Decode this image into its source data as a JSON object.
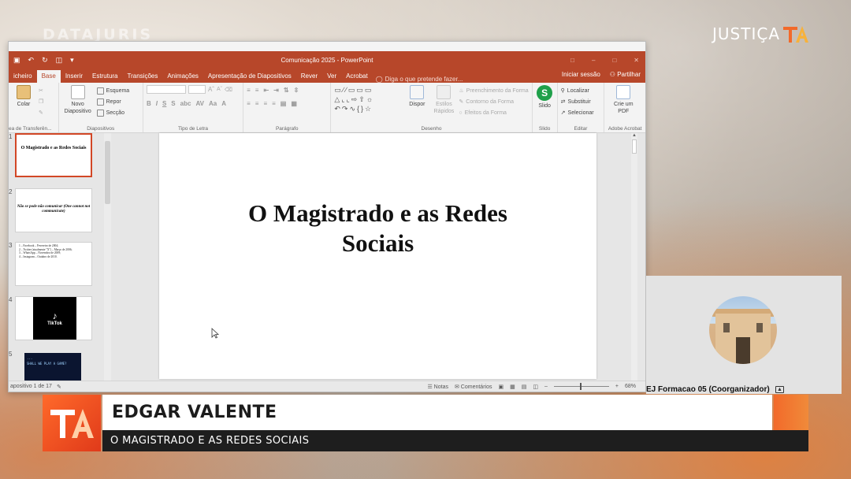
{
  "broadcast": {
    "left_watermark": "DATAJURIS",
    "brand_text": "JUSTIÇA",
    "brand_colors": {
      "accent": "#f26a2a",
      "lower_bar_dark": "#1e1e1e"
    }
  },
  "powerpoint": {
    "title": "Comunicação 2025 - PowerPoint",
    "tabs": [
      {
        "label": "icheiro"
      },
      {
        "label": "Base",
        "active": true
      },
      {
        "label": "Inserir"
      },
      {
        "label": "Estrutura"
      },
      {
        "label": "Transições"
      },
      {
        "label": "Animações"
      },
      {
        "label": "Apresentação de Diapositivos"
      },
      {
        "label": "Rever"
      },
      {
        "label": "Ver"
      },
      {
        "label": "Acrobat"
      }
    ],
    "tell_me": "Diga o que pretende fazer...",
    "sign_in": "Iniciar sessão",
    "share": "Partilhar",
    "ribbon": {
      "clipboard": {
        "paste": "Colar",
        "label": "ea de Transferên..."
      },
      "slides": {
        "new_slide": "Novo Diapositivo",
        "layout": "Esquema",
        "reset": "Repor",
        "section": "Secção",
        "label": "Diapositivos"
      },
      "font": {
        "label": "Tipo de Letra"
      },
      "paragraph": {
        "label": "Parágrafo"
      },
      "drawing": {
        "arrange": "Dispor",
        "quick_styles": "Estilos Rápidos",
        "fill": "Preenchimento da Forma",
        "outline": "Contorno da Forma",
        "effects": "Efeitos da Forma",
        "label": "Desenho"
      },
      "slido": {
        "button": "Slido",
        "label": "Slido"
      },
      "editing": {
        "find": "Localizar",
        "replace": "Substituir",
        "select": "Selecionar",
        "label": "Editar"
      },
      "acrobat": {
        "create_pdf": "Crie um PDF",
        "label": "Adobe Acrobat"
      }
    },
    "thumbnails": [
      {
        "num": "1",
        "title": "O Magistrado e as Redes Sociais"
      },
      {
        "num": "2",
        "text": "Não se pode não comunicar (One cannot not communicate)"
      },
      {
        "num": "3",
        "lines": [
          "1 – Facebook – Fevereiro de 2004;",
          "2 – Twitter (atualmente \"X\") – Março de 2006;",
          "3 – WhatsApp – Novembro de 2009;",
          "4 – Instagram – Outubro de 2010."
        ]
      },
      {
        "num": "4",
        "label": "TikTok"
      },
      {
        "num": "5",
        "lines": [
          "...",
          "SHALL WE PLAY A GAME?"
        ]
      }
    ],
    "slide_title": "O Magistrado e as Redes Sociais",
    "status": {
      "slide_counter": "apositivo 1 de 17",
      "notes": "Notas",
      "comments": "Comentários",
      "zoom": "68%"
    }
  },
  "participant": {
    "name": "EJ Formacao 05  (Coorganizador)"
  },
  "lower_third": {
    "speaker": "EDGAR VALENTE",
    "topic": "O MAGISTRADO E AS REDES SOCIAIS"
  }
}
